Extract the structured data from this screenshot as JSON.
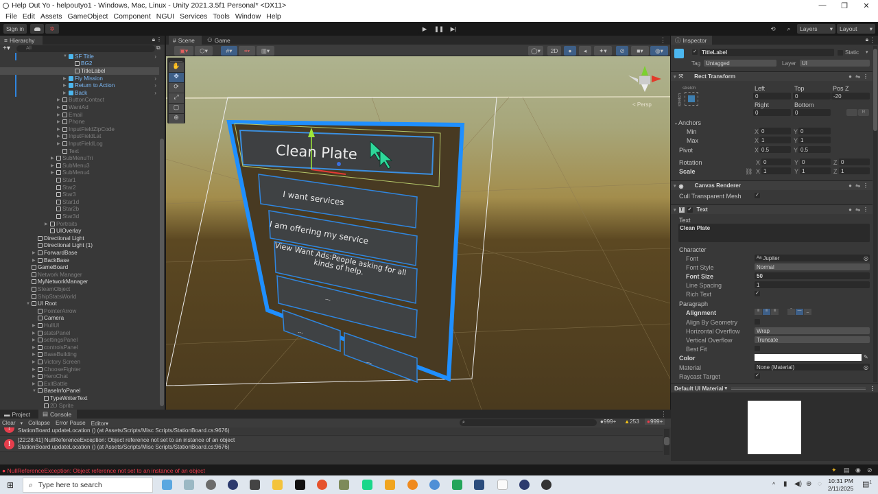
{
  "window": {
    "title": "Help Out Yo - helpoutyo1 - Windows, Mac, Linux - Unity 2021.3.5f1 Personal* <DX11>",
    "controls": [
      "—",
      "❐",
      "✕"
    ]
  },
  "menu": [
    "File",
    "Edit",
    "Assets",
    "GameObject",
    "Component",
    "NGUI",
    "Services",
    "Tools",
    "Window",
    "Help"
  ],
  "toolbar": {
    "sign_in": "Sign in",
    "layers": "Layers",
    "layout": "Layout",
    "play_icons": [
      "play-icon",
      "pause-icon",
      "step-icon"
    ]
  },
  "hierarchy": {
    "tab": "Hierarchy",
    "search_placeholder": "All",
    "items": [
      {
        "label": "SF Title",
        "depth": 6,
        "arrow": "down",
        "style": "blue",
        "prefab": true
      },
      {
        "label": "BG2",
        "depth": 7,
        "arrow": "",
        "style": "blue",
        "prefab": false
      },
      {
        "label": "TitleLabel",
        "depth": 7,
        "arrow": "",
        "style": "white",
        "prefab": false,
        "selected": true
      },
      {
        "label": "Fly Mission",
        "depth": 6,
        "arrow": "right",
        "style": "blue",
        "prefab": true
      },
      {
        "label": "Return to Action",
        "depth": 6,
        "arrow": "right",
        "style": "blue",
        "prefab": true
      },
      {
        "label": "Back",
        "depth": 6,
        "arrow": "right",
        "style": "blue",
        "prefab": true
      },
      {
        "label": "ButtonContact",
        "depth": 5,
        "arrow": "right",
        "style": "dim"
      },
      {
        "label": "WantAd",
        "depth": 5,
        "arrow": "right",
        "style": "dim"
      },
      {
        "label": "Email",
        "depth": 5,
        "arrow": "right",
        "style": "dim"
      },
      {
        "label": "Phone",
        "depth": 5,
        "arrow": "right",
        "style": "dim"
      },
      {
        "label": "InputFieldZipCode",
        "depth": 5,
        "arrow": "right",
        "style": "dim"
      },
      {
        "label": "InputFieldLat",
        "depth": 5,
        "arrow": "right",
        "style": "dim"
      },
      {
        "label": "InputFieldLog",
        "depth": 5,
        "arrow": "right",
        "style": "dim"
      },
      {
        "label": "Text",
        "depth": 5,
        "arrow": "",
        "style": "dim"
      },
      {
        "label": "SubMenuTri",
        "depth": 4,
        "arrow": "right",
        "style": "dim"
      },
      {
        "label": "SubMenu3",
        "depth": 4,
        "arrow": "right",
        "style": "dim"
      },
      {
        "label": "SubMenu4",
        "depth": 4,
        "arrow": "right",
        "style": "dim"
      },
      {
        "label": "Star1",
        "depth": 4,
        "arrow": "",
        "style": "dim"
      },
      {
        "label": "Star2",
        "depth": 4,
        "arrow": "",
        "style": "dim"
      },
      {
        "label": "Star3",
        "depth": 4,
        "arrow": "",
        "style": "dim"
      },
      {
        "label": "Star1d",
        "depth": 4,
        "arrow": "",
        "style": "dim"
      },
      {
        "label": "Star2b",
        "depth": 4,
        "arrow": "",
        "style": "dim"
      },
      {
        "label": "Star3d",
        "depth": 4,
        "arrow": "",
        "style": "dim"
      },
      {
        "label": "Portraits",
        "depth": 3,
        "arrow": "right",
        "style": "dim"
      },
      {
        "label": "UIOverlay",
        "depth": 3,
        "arrow": "",
        "style": "white"
      },
      {
        "label": "Directional Light",
        "depth": 1,
        "arrow": "",
        "style": "white"
      },
      {
        "label": "Directional Light (1)",
        "depth": 1,
        "arrow": "",
        "style": "white"
      },
      {
        "label": "ForwardBase",
        "depth": 1,
        "arrow": "right",
        "style": "white"
      },
      {
        "label": "BackBase",
        "depth": 1,
        "arrow": "right",
        "style": "white"
      },
      {
        "label": "GameBoard",
        "depth": 0,
        "arrow": "",
        "style": "white"
      },
      {
        "label": "Network Manager",
        "depth": 0,
        "arrow": "",
        "style": "dim"
      },
      {
        "label": "MyNetworkManager",
        "depth": 0,
        "arrow": "",
        "style": "white"
      },
      {
        "label": "SteamObject",
        "depth": 0,
        "arrow": "",
        "style": "dim"
      },
      {
        "label": "ShipStatsWorld",
        "depth": 0,
        "arrow": "",
        "style": "dim"
      },
      {
        "label": "UI Root",
        "depth": 0,
        "arrow": "down",
        "style": "white"
      },
      {
        "label": "PointerArrow",
        "depth": 1,
        "arrow": "",
        "style": "dim"
      },
      {
        "label": "Camera",
        "depth": 1,
        "arrow": "",
        "style": "white"
      },
      {
        "label": "HullUI",
        "depth": 1,
        "arrow": "right",
        "style": "dim"
      },
      {
        "label": "statsPanel",
        "depth": 1,
        "arrow": "right",
        "style": "dim"
      },
      {
        "label": "settingsPanel",
        "depth": 1,
        "arrow": "right",
        "style": "dim"
      },
      {
        "label": "controlsPanel",
        "depth": 1,
        "arrow": "right",
        "style": "dim"
      },
      {
        "label": "BaseBuilding",
        "depth": 1,
        "arrow": "right",
        "style": "dim"
      },
      {
        "label": "Victory Screen",
        "depth": 1,
        "arrow": "right",
        "style": "dim"
      },
      {
        "label": "ChooseFighter",
        "depth": 1,
        "arrow": "right",
        "style": "dim"
      },
      {
        "label": "HeroChat",
        "depth": 1,
        "arrow": "right",
        "style": "dim"
      },
      {
        "label": "ExitBattle",
        "depth": 1,
        "arrow": "right",
        "style": "dim"
      },
      {
        "label": "BaseInfoPanel",
        "depth": 1,
        "arrow": "down",
        "style": "white"
      },
      {
        "label": "TypeWriterText",
        "depth": 2,
        "arrow": "",
        "style": "white"
      },
      {
        "label": "2D Sprite",
        "depth": 2,
        "arrow": "",
        "style": "dim"
      }
    ]
  },
  "scene": {
    "tabs": [
      "Scene",
      "Game"
    ],
    "toolbar_2d": "2D",
    "persp_label": "< Persp",
    "tools": [
      "hand-tool",
      "move-tool",
      "rotate-tool",
      "scale-tool",
      "rect-tool",
      "transform-tool"
    ],
    "panel": {
      "title": "Clean Plate",
      "buttons": [
        "I want services",
        "I am offering my service",
        "View Want Ads:People asking for all kinds of help.",
        "---",
        "---",
        "---"
      ]
    }
  },
  "inspector": {
    "tab": "Inspector",
    "object_name": "TitleLabel",
    "active": true,
    "static_label": "Static",
    "tag_label": "Tag",
    "tag_value": "Untagged",
    "layer_label": "Layer",
    "layer_value": "UI",
    "rect_transform": {
      "title": "Rect Transform",
      "anchor_preset_h": "stretch",
      "anchor_preset_v": "stretch",
      "left_label": "Left",
      "left": "0",
      "top_label": "Top",
      "top": "0",
      "posz_label": "Pos Z",
      "posz": "-20",
      "right_label": "Right",
      "right": "0",
      "bottom_label": "Bottom",
      "bottom": "0",
      "r_button": "R",
      "anchors_label": "Anchors",
      "min_label": "Min",
      "min_x": "0",
      "min_y": "0",
      "max_label": "Max",
      "max_x": "1",
      "max_y": "1",
      "pivot_label": "Pivot",
      "pivot_x": "0.5",
      "pivot_y": "0.5",
      "rotation_label": "Rotation",
      "rot_x": "0",
      "rot_y": "0",
      "rot_z": "0",
      "scale_label": "Scale",
      "scale_x": "1",
      "scale_y": "1",
      "scale_z": "1"
    },
    "canvas_renderer": {
      "title": "Canvas Renderer",
      "cull_label": "Cull Transparent Mesh",
      "cull": true
    },
    "text": {
      "title": "Text",
      "text_label": "Text",
      "text_value": "Clean Plate",
      "character_label": "Character",
      "font_label": "Font",
      "font_value": "Jupiter",
      "font_style_label": "Font Style",
      "font_style_value": "Normal",
      "font_size_label": "Font Size",
      "font_size_value": "50",
      "line_spacing_label": "Line Spacing",
      "line_spacing_value": "1",
      "rich_text_label": "Rich Text",
      "rich_text": true,
      "paragraph_label": "Paragraph",
      "alignment_label": "Alignment",
      "align_geometry_label": "Align By Geometry",
      "align_geometry": false,
      "h_overflow_label": "Horizontal Overflow",
      "h_overflow_value": "Wrap",
      "v_overflow_label": "Vertical Overflow",
      "v_overflow_value": "Truncate",
      "best_fit_label": "Best Fit",
      "best_fit": false,
      "color_label": "Color",
      "color_value": "#ffffff",
      "material_label": "Material",
      "material_value": "None (Material)",
      "raycast_label": "Raycast Target",
      "raycast": true
    },
    "material_preview": "Default UI Material"
  },
  "console": {
    "tabs": [
      "Project",
      "Console"
    ],
    "buttons": [
      "Clear",
      "Collapse",
      "Error Pause",
      "Editor"
    ],
    "log_count": "999+",
    "warn_count": "253",
    "error_count": "999+",
    "entries": [
      {
        "line1": "",
        "line2": "StationBoard.updateLocation () (at Assets/Scripts/Misc Scripts/StationBoard.cs:9676)"
      },
      {
        "line1": "[22:28:41] NullReferenceException: Object reference not set to an instance of an object",
        "line2": "StationBoard.updateLocation () (at Assets/Scripts/Misc Scripts/StationBoard.cs:9676)"
      }
    ],
    "status_message": "NullReferenceException: Object reference not set to an instance of an object"
  },
  "taskbar": {
    "search_placeholder": "Type here to search",
    "time": "10:31 PM",
    "date": "2/11/2025",
    "notification_count": "1"
  }
}
